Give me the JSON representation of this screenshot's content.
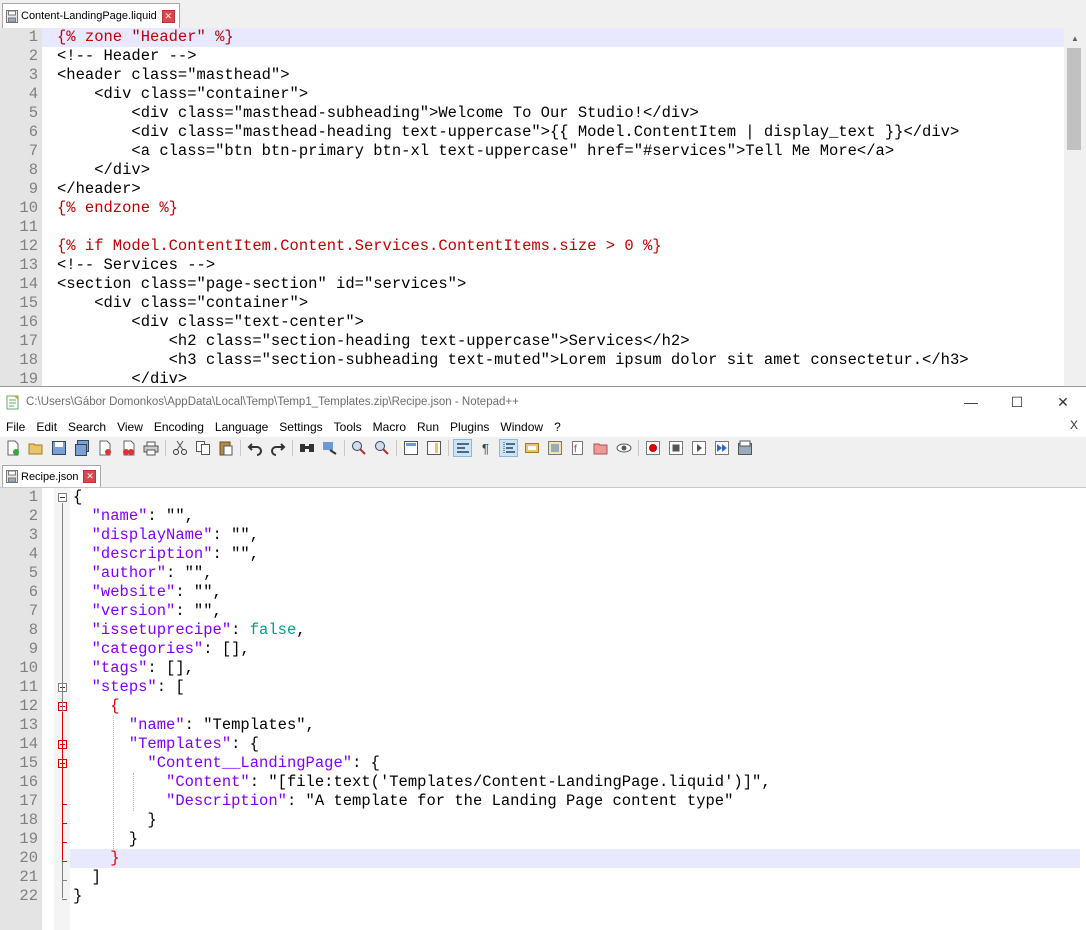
{
  "top_editor": {
    "tab_label": "Content-LandingPage.liquid",
    "lines": [
      "{% zone \"Header\" %}",
      "<!-- Header -->",
      "<header class=\"masthead\">",
      "    <div class=\"container\">",
      "        <div class=\"masthead-subheading\">Welcome To Our Studio!</div>",
      "        <div class=\"masthead-heading text-uppercase\">{{ Model.ContentItem | display_text }}</div>",
      "        <a class=\"btn btn-primary btn-xl text-uppercase\" href=\"#services\">Tell Me More</a>",
      "    </div>",
      "</header>",
      "{% endzone %}",
      "",
      "{% if Model.ContentItem.Content.Services.ContentItems.size > 0 %}",
      "<!-- Services -->",
      "<section class=\"page-section\" id=\"services\">",
      "    <div class=\"container\">",
      "        <div class=\"text-center\">",
      "            <h2 class=\"section-heading text-uppercase\">Services</h2>",
      "            <h3 class=\"section-subheading text-muted\">Lorem ipsum dolor sit amet consectetur.</h3>",
      "        </div>"
    ],
    "line_numbers": [
      "1",
      "2",
      "3",
      "4",
      "5",
      "6",
      "7",
      "8",
      "9",
      "10",
      "11",
      "12",
      "13",
      "14",
      "15",
      "16",
      "17",
      "18",
      "19"
    ]
  },
  "npp_window": {
    "title": "C:\\Users\\Gábor Domonkos\\AppData\\Local\\Temp\\Temp1_Templates.zip\\Recipe.json - Notepad++",
    "minimize_label": "—",
    "maximize_label": "☐",
    "close_label": "✕",
    "menu": [
      "File",
      "Edit",
      "Search",
      "View",
      "Encoding",
      "Language",
      "Settings",
      "Tools",
      "Macro",
      "Run",
      "Plugins",
      "Window",
      "?"
    ],
    "menu_close": "X",
    "tab_label": "Recipe.json",
    "line_numbers": [
      "1",
      "2",
      "3",
      "4",
      "5",
      "6",
      "7",
      "8",
      "9",
      "10",
      "11",
      "12",
      "13",
      "14",
      "15",
      "16",
      "17",
      "18",
      "19",
      "20",
      "21",
      "22"
    ],
    "json_lines": [
      [
        {
          "t": "{",
          "c": "jp"
        }
      ],
      [
        {
          "t": "  ",
          "c": "jp"
        },
        {
          "t": "\"name\"",
          "c": "jk"
        },
        {
          "t": ": \"\",",
          "c": "jp"
        }
      ],
      [
        {
          "t": "  ",
          "c": "jp"
        },
        {
          "t": "\"displayName\"",
          "c": "jk"
        },
        {
          "t": ": \"\",",
          "c": "jp"
        }
      ],
      [
        {
          "t": "  ",
          "c": "jp"
        },
        {
          "t": "\"description\"",
          "c": "jk"
        },
        {
          "t": ": \"\",",
          "c": "jp"
        }
      ],
      [
        {
          "t": "  ",
          "c": "jp"
        },
        {
          "t": "\"author\"",
          "c": "jk"
        },
        {
          "t": ": \"\",",
          "c": "jp"
        }
      ],
      [
        {
          "t": "  ",
          "c": "jp"
        },
        {
          "t": "\"website\"",
          "c": "jk"
        },
        {
          "t": ": \"\",",
          "c": "jp"
        }
      ],
      [
        {
          "t": "  ",
          "c": "jp"
        },
        {
          "t": "\"version\"",
          "c": "jk"
        },
        {
          "t": ": \"\",",
          "c": "jp"
        }
      ],
      [
        {
          "t": "  ",
          "c": "jp"
        },
        {
          "t": "\"issetuprecipe\"",
          "c": "jk"
        },
        {
          "t": ": ",
          "c": "jp"
        },
        {
          "t": "false",
          "c": "jb"
        },
        {
          "t": ",",
          "c": "jp"
        }
      ],
      [
        {
          "t": "  ",
          "c": "jp"
        },
        {
          "t": "\"categories\"",
          "c": "jk"
        },
        {
          "t": ": [],",
          "c": "jp"
        }
      ],
      [
        {
          "t": "  ",
          "c": "jp"
        },
        {
          "t": "\"tags\"",
          "c": "jk"
        },
        {
          "t": ": [],",
          "c": "jp"
        }
      ],
      [
        {
          "t": "  ",
          "c": "jp"
        },
        {
          "t": "\"steps\"",
          "c": "jk"
        },
        {
          "t": ": [",
          "c": "jp"
        }
      ],
      [
        {
          "t": "    ",
          "c": "jp"
        },
        {
          "t": "{",
          "c": "br"
        }
      ],
      [
        {
          "t": "      ",
          "c": "jp"
        },
        {
          "t": "\"name\"",
          "c": "jk"
        },
        {
          "t": ": \"Templates\",",
          "c": "jp"
        }
      ],
      [
        {
          "t": "      ",
          "c": "jp"
        },
        {
          "t": "\"Templates\"",
          "c": "jk"
        },
        {
          "t": ": {",
          "c": "jp"
        }
      ],
      [
        {
          "t": "        ",
          "c": "jp"
        },
        {
          "t": "\"Content__LandingPage\"",
          "c": "jk"
        },
        {
          "t": ": {",
          "c": "jp"
        }
      ],
      [
        {
          "t": "          ",
          "c": "jp"
        },
        {
          "t": "\"Content\"",
          "c": "jk"
        },
        {
          "t": ": \"[file:text('Templates/Content-LandingPage.liquid')]\",",
          "c": "jp"
        }
      ],
      [
        {
          "t": "          ",
          "c": "jp"
        },
        {
          "t": "\"Description\"",
          "c": "jk"
        },
        {
          "t": ": \"A template for the Landing Page content type\"",
          "c": "jp"
        }
      ],
      [
        {
          "t": "        }",
          "c": "jp"
        }
      ],
      [
        {
          "t": "      }",
          "c": "jp"
        }
      ],
      [
        {
          "t": "    ",
          "c": "jp"
        },
        {
          "t": "}",
          "c": "br"
        }
      ],
      [
        {
          "t": "  ]",
          "c": "jp"
        }
      ],
      [
        {
          "t": "}",
          "c": "jp"
        }
      ]
    ]
  }
}
